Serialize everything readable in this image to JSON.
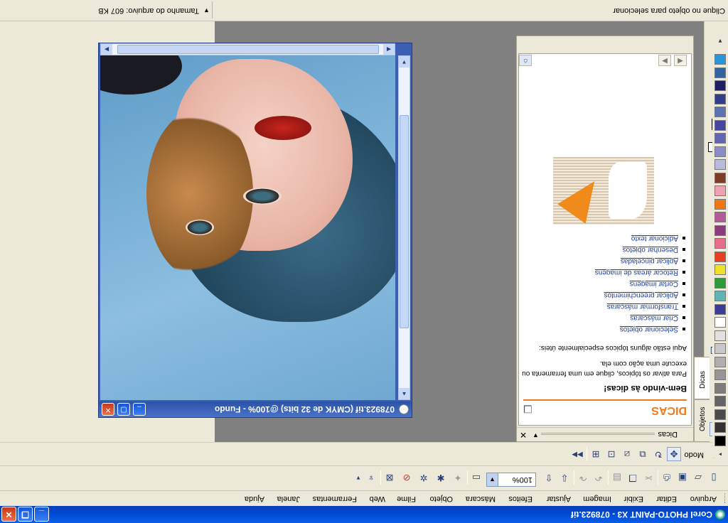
{
  "window": {
    "title": "Corel PHOTO-PAINT X3 - 078923.tif",
    "minimize": "_",
    "restore": "❐",
    "close": "✕"
  },
  "menu": [
    {
      "label": "Arquivo"
    },
    {
      "label": "Editar"
    },
    {
      "label": "Exibir"
    },
    {
      "label": "Imagem"
    },
    {
      "label": "Ajustar"
    },
    {
      "label": "Efeitos"
    },
    {
      "label": "Máscara"
    },
    {
      "label": "Objeto"
    },
    {
      "label": "Filme"
    },
    {
      "label": "Web"
    },
    {
      "label": "Ferramentas"
    },
    {
      "label": "Janela"
    },
    {
      "label": "Ajuda"
    }
  ],
  "standard_toolbar": {
    "zoom_value": "100%",
    "icons": [
      "new-icon",
      "open-icon",
      "save-icon",
      "print-icon",
      "cut-icon",
      "copy-icon",
      "paste-icon",
      "undo-icon",
      "redo-icon",
      "import-icon",
      "export-icon",
      "full-screen-icon",
      "corel-icon",
      "paint-icon",
      "mask-icon",
      "object-icon",
      "brush-icon"
    ]
  },
  "property_bar": {
    "mode_label": "Modo"
  },
  "document": {
    "title": "078923.tif (CMYK de 32 bits) @100% - Fundo"
  },
  "docker": {
    "header_title": "Dicas",
    "tabs": [
      {
        "label": "Objetos"
      },
      {
        "label": "Dicas"
      }
    ],
    "tips": {
      "heading": "DICAS",
      "welcome": "Bem-vindo às dicas!",
      "intro": "Para ativar os tópicos, clique em uma ferramenta ou execute uma ação com ela.",
      "lead": "Aqui estão alguns tópicos especialmente úteis:",
      "topics": [
        {
          "label": "Selecionar objetos"
        },
        {
          "label": "Criar máscaras"
        },
        {
          "label": "Transformar máscaras"
        },
        {
          "label": "Aplicar preenchimentos"
        },
        {
          "label": "Cortar imagens"
        },
        {
          "label": "Retocar áreas de imagens"
        },
        {
          "label": "Aplicar pinceladas"
        },
        {
          "label": "Desenhar objetos"
        },
        {
          "label": "Adicionar texto"
        }
      ]
    }
  },
  "palette": {
    "colors": [
      "#000000",
      "#323232",
      "#4b4b4b",
      "#646464",
      "#7d7d7d",
      "#969696",
      "#afafaf",
      "#c8c8c8",
      "#e1e1e1",
      "#ffffff",
      "#3c3c96",
      "#5fb5b5",
      "#2e9a3a",
      "#f0e028",
      "#e8401c",
      "#e86d8c",
      "#8c3c7d",
      "#b45a9b",
      "#f07814",
      "#f0a0b4",
      "#7d3c28",
      "#b9b9e1",
      "#8c8cc8",
      "#6464b4",
      "#4646a0",
      "#5a73b4",
      "#323c8c",
      "#1e1e64",
      "#3264a0",
      "#2896dc"
    ]
  },
  "status": {
    "file_size": "Tamanho do arquivo: 607 KB",
    "hint": "Clique no objeto para selecionar"
  },
  "colors": {
    "titlebar": "#0048d0",
    "tips_orange": "#f07a1a",
    "link_blue": "#1a3f9a",
    "fill_color": "#e8401c"
  }
}
